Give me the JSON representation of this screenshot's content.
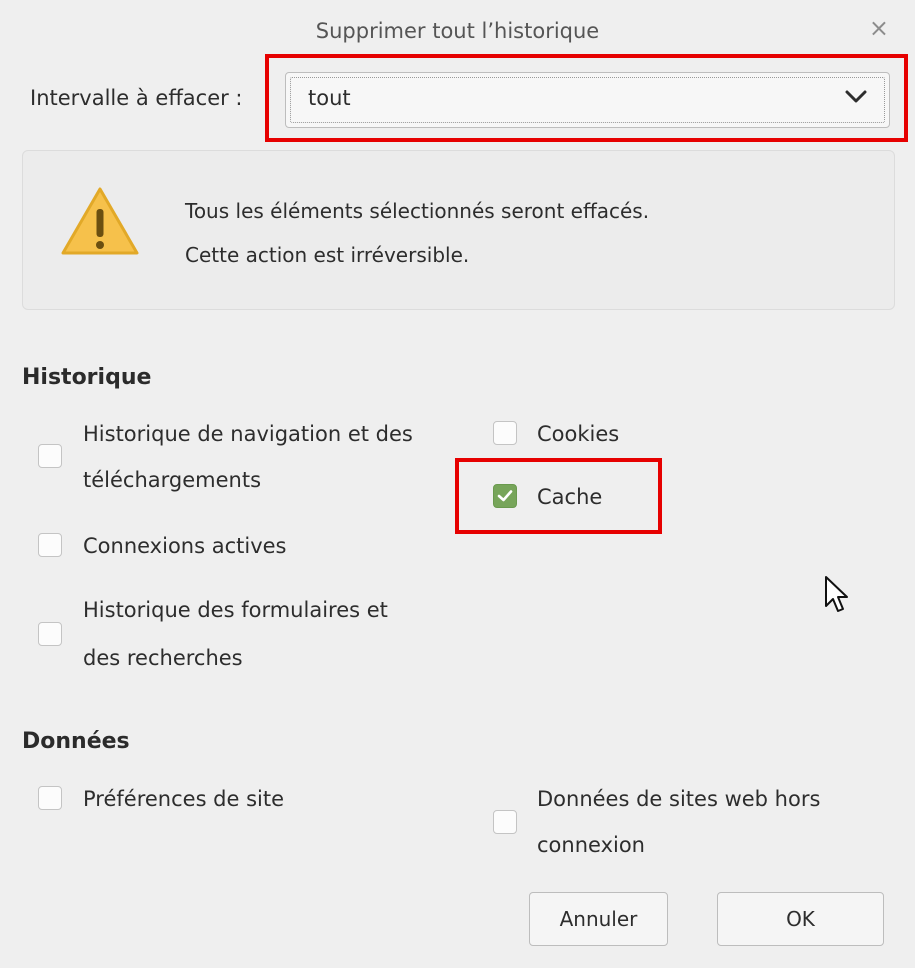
{
  "dialog": {
    "title": "Supprimer tout l’historique",
    "close_glyph": "×"
  },
  "range": {
    "label": "Intervalle à effacer :",
    "selected": "tout"
  },
  "warning": {
    "icon": "warning-triangle-icon",
    "line1": "Tous les éléments sélectionnés seront effacés.",
    "line2": "Cette action est irréversible."
  },
  "historique": {
    "title": "Historique",
    "items": [
      {
        "label_line1": "Historique de navigation et des",
        "label_line2": "téléchargements",
        "checked": false
      },
      {
        "label": "Cookies",
        "checked": false
      },
      {
        "label": "Cache",
        "checked": true
      },
      {
        "label": "Connexions actives",
        "checked": false
      },
      {
        "label_line1": "Historique des formulaires et",
        "label_line2": "des recherches",
        "checked": false
      }
    ]
  },
  "donnees": {
    "title": "Données",
    "items": [
      {
        "label": "Préférences de site",
        "checked": false
      },
      {
        "label_line1": "Données de sites web hors",
        "label_line2": "connexion",
        "checked": false
      }
    ]
  },
  "buttons": {
    "cancel": "Annuler",
    "ok": "OK"
  },
  "colors": {
    "highlight": "#e60000",
    "checkbox_checked": "#77a55a",
    "warning_yellow": "#f6c14b"
  }
}
